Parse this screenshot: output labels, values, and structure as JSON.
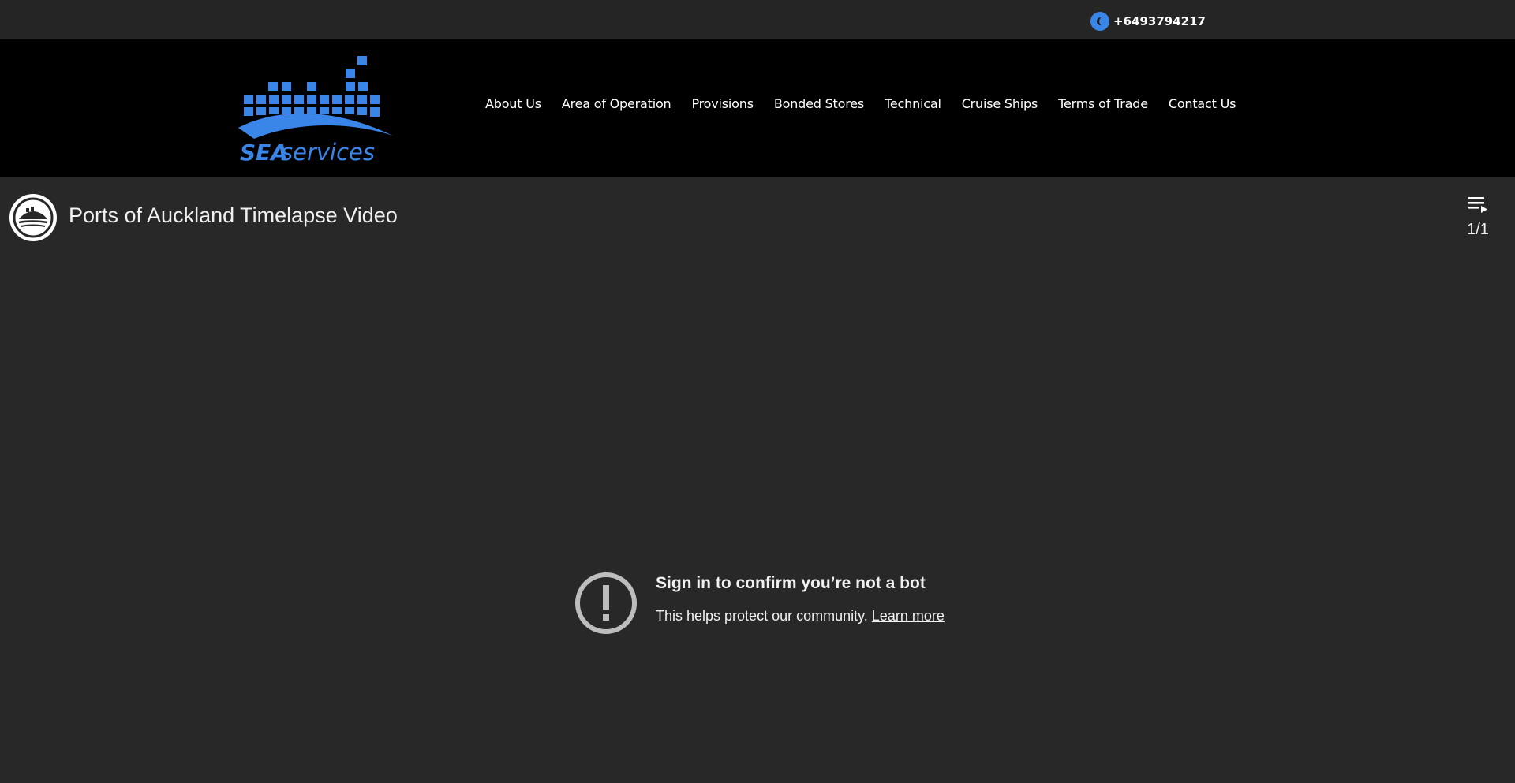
{
  "topbar": {
    "phone": "+6493794217",
    "phone_icon": "phone-icon",
    "accent_color": "#3a86e8"
  },
  "header": {
    "logo_text": "SEA services",
    "nav": [
      {
        "label": "About Us"
      },
      {
        "label": "Area of Operation"
      },
      {
        "label": "Provisions"
      },
      {
        "label": "Bonded Stores"
      },
      {
        "label": "Technical"
      },
      {
        "label": "Cruise Ships"
      },
      {
        "label": "Terms of Trade"
      },
      {
        "label": "Contact Us"
      }
    ]
  },
  "video": {
    "title": "Ports of Auckland Timelapse Video",
    "playlist_count": "1/1",
    "error_title": "Sign in to confirm you’re not a bot",
    "error_message": "This helps protect our community.",
    "learn_more": "Learn more"
  }
}
